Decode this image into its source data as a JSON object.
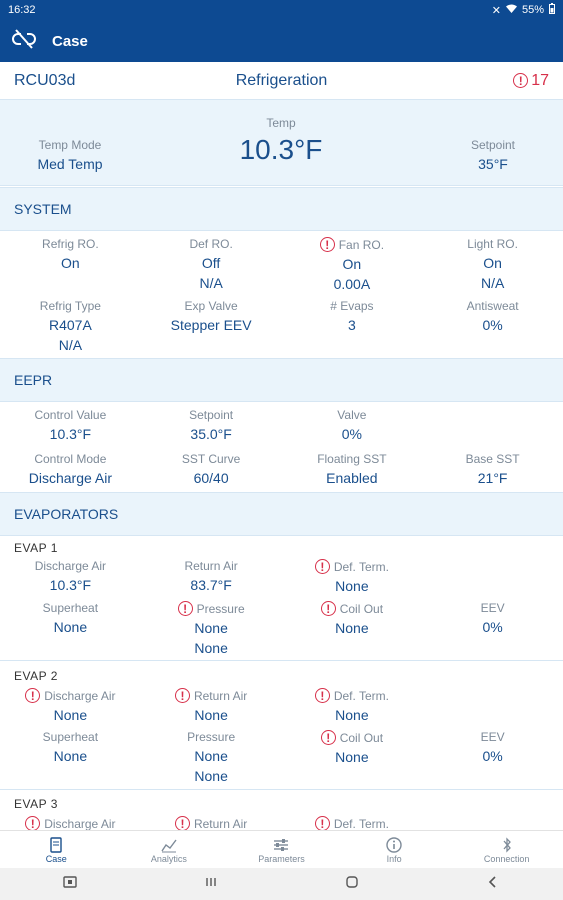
{
  "status": {
    "time": "16:32",
    "battery": "55%"
  },
  "appbar": {
    "title": "Case"
  },
  "case": {
    "id": "RCU03d",
    "type": "Refrigeration",
    "alarm_count": "17"
  },
  "summary": {
    "temp_mode_label": "Temp Mode",
    "temp_mode_value": "Med Temp",
    "temp_label": "Temp",
    "temp_value": "10.3°F",
    "setpoint_label": "Setpoint",
    "setpoint_value": "35°F"
  },
  "system": {
    "title": "SYSTEM",
    "row1": [
      {
        "label": "Refrig RO.",
        "values": [
          "On"
        ],
        "alert": false
      },
      {
        "label": "Def RO.",
        "values": [
          "Off",
          "N/A"
        ],
        "alert": false
      },
      {
        "label": "Fan RO.",
        "values": [
          "On",
          "0.00A"
        ],
        "alert": true
      },
      {
        "label": "Light RO.",
        "values": [
          "On",
          "N/A"
        ],
        "alert": false
      }
    ],
    "row2": [
      {
        "label": "Refrig Type",
        "values": [
          "R407A",
          "N/A"
        ],
        "alert": false
      },
      {
        "label": "Exp Valve",
        "values": [
          "Stepper EEV"
        ],
        "alert": false
      },
      {
        "label": "# Evaps",
        "values": [
          "3"
        ],
        "alert": false
      },
      {
        "label": "Antisweat",
        "values": [
          "0%"
        ],
        "alert": false
      }
    ]
  },
  "eepr": {
    "title": "EEPR",
    "row1": [
      {
        "label": "Control Value",
        "values": [
          "10.3°F"
        ],
        "alert": false
      },
      {
        "label": "Setpoint",
        "values": [
          "35.0°F"
        ],
        "alert": false
      },
      {
        "label": "Valve",
        "values": [
          "0%"
        ],
        "alert": false
      }
    ],
    "row2": [
      {
        "label": "Control Mode",
        "values": [
          "Discharge Air"
        ],
        "alert": false
      },
      {
        "label": "SST Curve",
        "values": [
          "60/40"
        ],
        "alert": false
      },
      {
        "label": "Floating SST",
        "values": [
          "Enabled"
        ],
        "alert": false
      },
      {
        "label": "Base SST",
        "values": [
          "21°F"
        ],
        "alert": false
      }
    ]
  },
  "evaporators": {
    "title": "EVAPORATORS",
    "evap1": {
      "title": "EVAP 1",
      "row1": [
        {
          "label": "Discharge Air",
          "values": [
            "10.3°F"
          ],
          "alert": false
        },
        {
          "label": "Return Air",
          "values": [
            "83.7°F"
          ],
          "alert": false
        },
        {
          "label": "Def. Term.",
          "values": [
            "None"
          ],
          "alert": true
        }
      ],
      "row2": [
        {
          "label": "Superheat",
          "values": [
            "None"
          ],
          "alert": false
        },
        {
          "label": "Pressure",
          "values": [
            "None",
            "None"
          ],
          "alert": true
        },
        {
          "label": "Coil Out",
          "values": [
            "None"
          ],
          "alert": true
        },
        {
          "label": "EEV",
          "values": [
            "0%"
          ],
          "alert": false
        }
      ]
    },
    "evap2": {
      "title": "EVAP 2",
      "row1": [
        {
          "label": "Discharge Air",
          "values": [
            "None"
          ],
          "alert": true
        },
        {
          "label": "Return Air",
          "values": [
            "None"
          ],
          "alert": true
        },
        {
          "label": "Def. Term.",
          "values": [
            "None"
          ],
          "alert": true
        }
      ],
      "row2": [
        {
          "label": "Superheat",
          "values": [
            "None"
          ],
          "alert": false
        },
        {
          "label": "Pressure",
          "values": [
            "None",
            "None"
          ],
          "alert": false
        },
        {
          "label": "Coil Out",
          "values": [
            "None"
          ],
          "alert": true
        },
        {
          "label": "EEV",
          "values": [
            "0%"
          ],
          "alert": false
        }
      ]
    },
    "evap3": {
      "title": "EVAP 3",
      "row1": [
        {
          "label": "Discharge Air",
          "values": [],
          "alert": true
        },
        {
          "label": "Return Air",
          "values": [],
          "alert": true
        },
        {
          "label": "Def. Term.",
          "values": [],
          "alert": true
        }
      ]
    }
  },
  "nav": [
    {
      "label": "Case",
      "icon": "case-icon",
      "active": true
    },
    {
      "label": "Analytics",
      "icon": "analytics-icon",
      "active": false
    },
    {
      "label": "Parameters",
      "icon": "parameters-icon",
      "active": false
    },
    {
      "label": "Info",
      "icon": "info-icon",
      "active": false
    },
    {
      "label": "Connection",
      "icon": "connection-icon",
      "active": false
    }
  ],
  "colors": {
    "brand": "#0d4a92",
    "text": "#1a4f8c",
    "alarm": "#d7304a",
    "section_bg": "#eaf4fb"
  }
}
